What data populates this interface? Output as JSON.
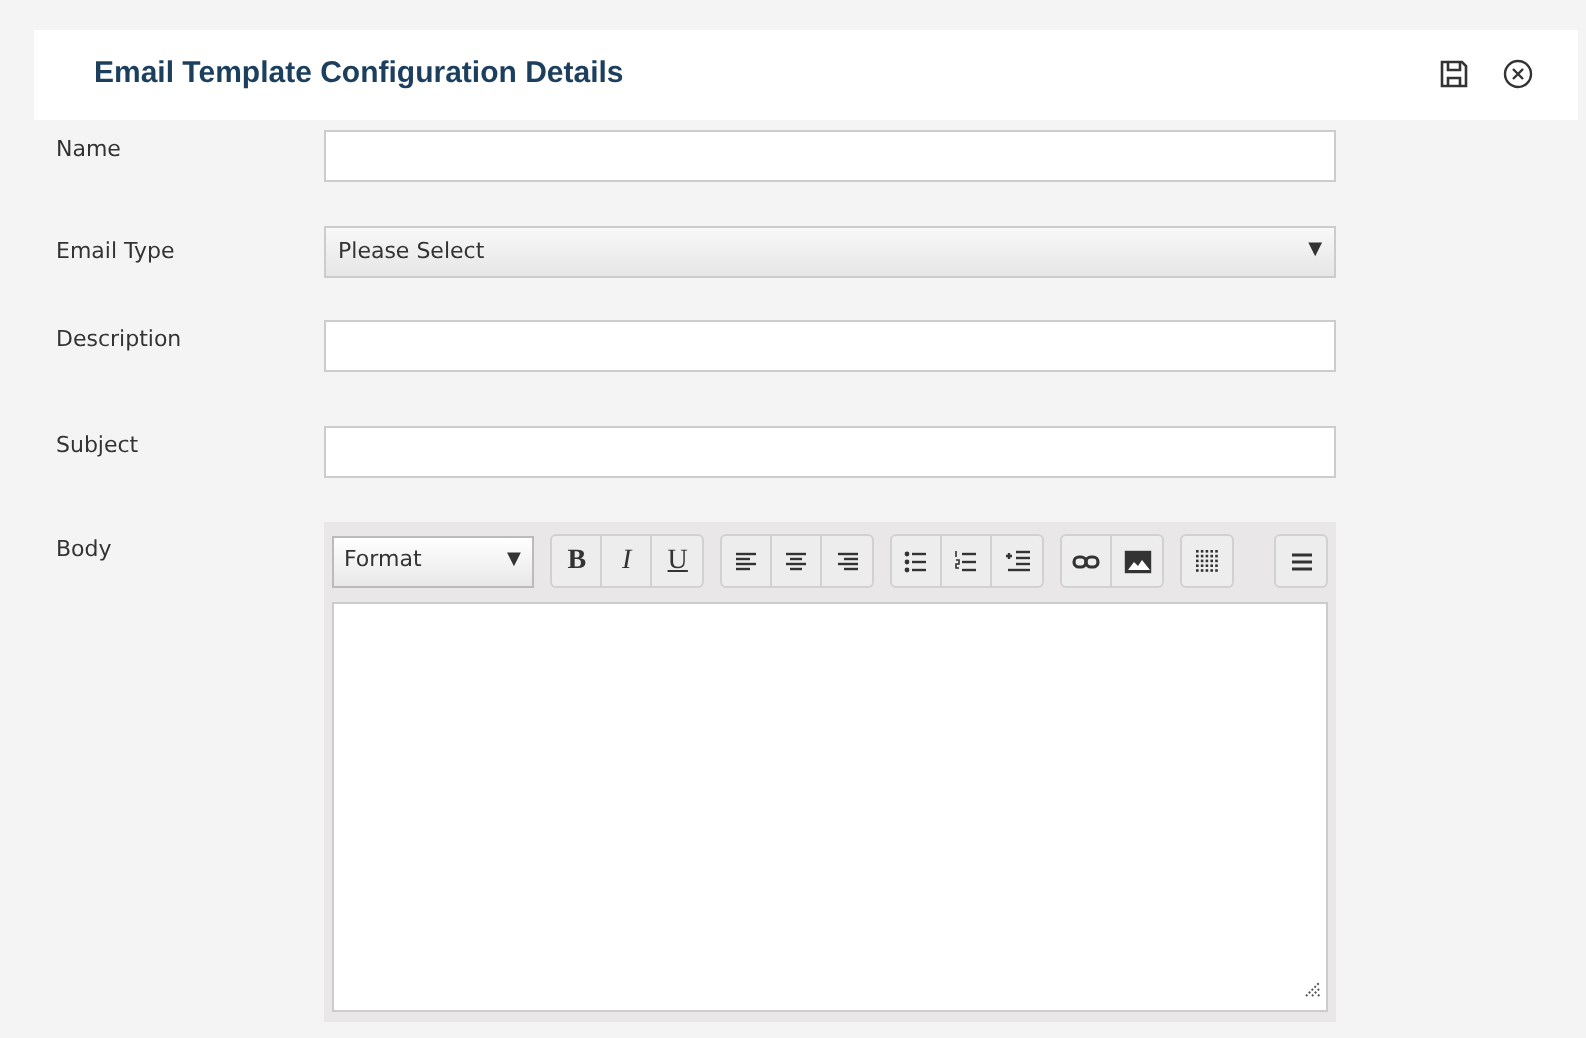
{
  "header": {
    "title": "Email Template Configuration Details"
  },
  "fields": [
    {
      "kind": "text",
      "label": "Name"
    },
    {
      "kind": "select",
      "label": "Email Type",
      "value": "Please Select",
      "caret": "▼"
    },
    {
      "kind": "text",
      "label": "Description"
    },
    {
      "kind": "text",
      "label": "Subject"
    },
    {
      "kind": "editor",
      "label": "Body"
    }
  ],
  "editor_toolbar": {
    "format": {
      "value": "Format",
      "caret": "▼"
    },
    "style_buttons": [
      "B",
      "I",
      "U"
    ]
  }
}
